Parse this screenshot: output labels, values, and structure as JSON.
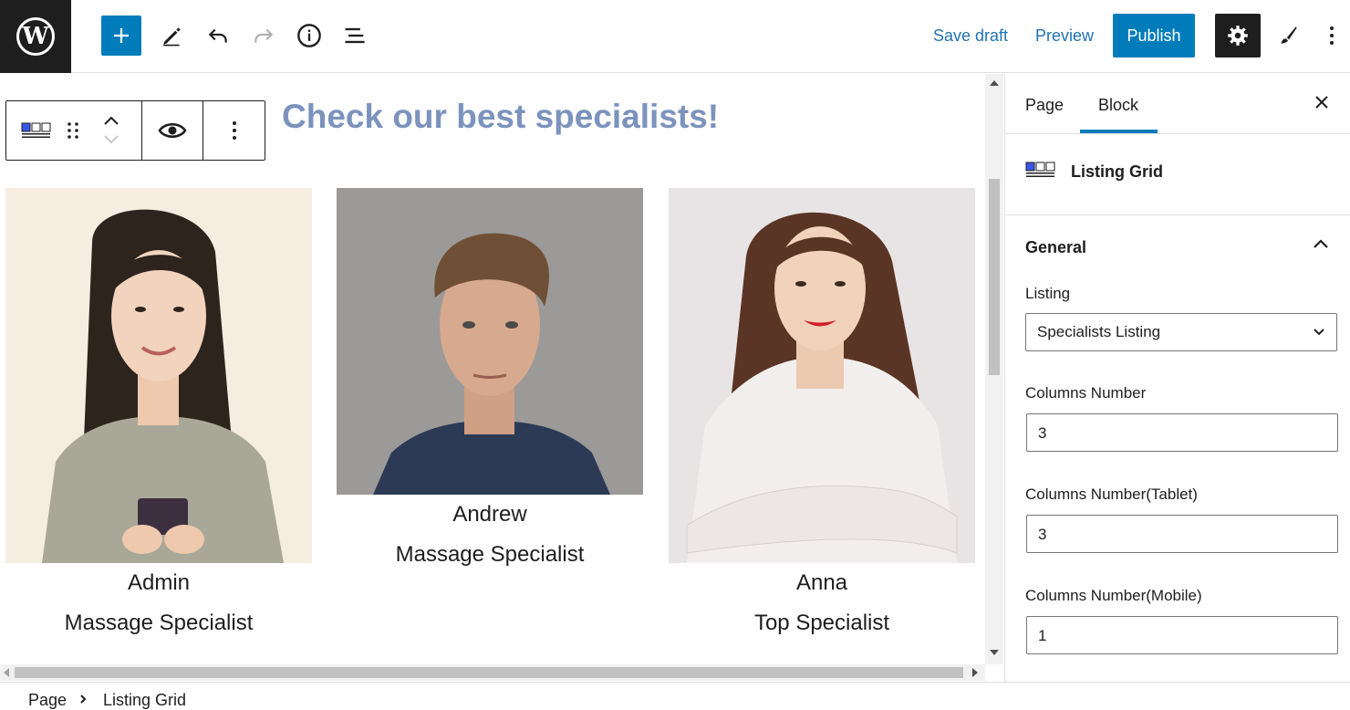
{
  "toolbar": {
    "save_draft": "Save draft",
    "preview": "Preview",
    "publish": "Publish"
  },
  "editor": {
    "heading": "Check our best specialists!",
    "heading_color": "#7b93bd",
    "specialists": [
      {
        "name": "Admin",
        "role": "Massage Specialist"
      },
      {
        "name": "Andrew",
        "role": "Massage Specialist"
      },
      {
        "name": "Anna",
        "role": "Top Specialist"
      }
    ]
  },
  "sidebar": {
    "tabs": [
      "Page",
      "Block"
    ],
    "active_tab": "Block",
    "block_title": "Listing Grid",
    "panel_title": "General",
    "fields": {
      "listing_label": "Listing",
      "listing_value": "Specialists Listing",
      "columns_label": "Columns Number",
      "columns_value": "3",
      "columns_tablet_label": "Columns Number(Tablet)",
      "columns_tablet_value": "3",
      "columns_mobile_label": "Columns Number(Mobile)",
      "columns_mobile_value": "1"
    }
  },
  "breadcrumb": [
    "Page",
    "Listing Grid"
  ],
  "colors": {
    "accent": "#007cba",
    "dark": "#1e1e1e"
  },
  "icons": [
    "wordpress-logo-icon",
    "plus-icon",
    "pencil-icon",
    "undo-icon",
    "redo-icon",
    "info-icon",
    "list-view-icon",
    "gear-icon",
    "brush-icon",
    "kebab-icon",
    "listing-grid-icon",
    "drag-icon",
    "move-up-icon",
    "move-down-icon",
    "eye-icon",
    "close-icon",
    "chevron-up-icon",
    "chevron-down-icon",
    "breadcrumb-chevron-icon"
  ]
}
